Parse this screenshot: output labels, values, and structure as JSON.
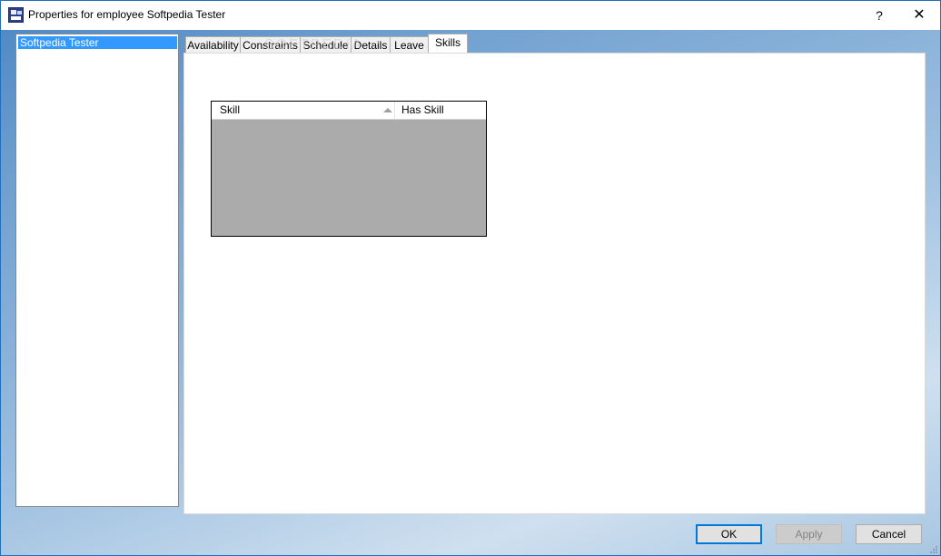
{
  "window": {
    "title": "Properties for employee Softpedia Tester",
    "help_label": "?",
    "close_label": "✕"
  },
  "employees": [
    {
      "name": "Softpedia Tester",
      "selected": true
    }
  ],
  "tabs": [
    {
      "label": "Availability"
    },
    {
      "label": "Constraints"
    },
    {
      "label": "Schedule"
    },
    {
      "label": "Details"
    },
    {
      "label": "Leave"
    },
    {
      "label": "Skills",
      "active": true
    }
  ],
  "watermark": "SOFTPEDIA",
  "skills_grid": {
    "columns": [
      "Skill",
      "Has Skill"
    ],
    "sort_column": "Skill",
    "rows": []
  },
  "buttons": {
    "ok": "OK",
    "apply": "Apply",
    "cancel": "Cancel"
  },
  "colors": {
    "selection": "#3399ff",
    "ok_border": "#0078d7",
    "grid_empty": "#ababab"
  }
}
